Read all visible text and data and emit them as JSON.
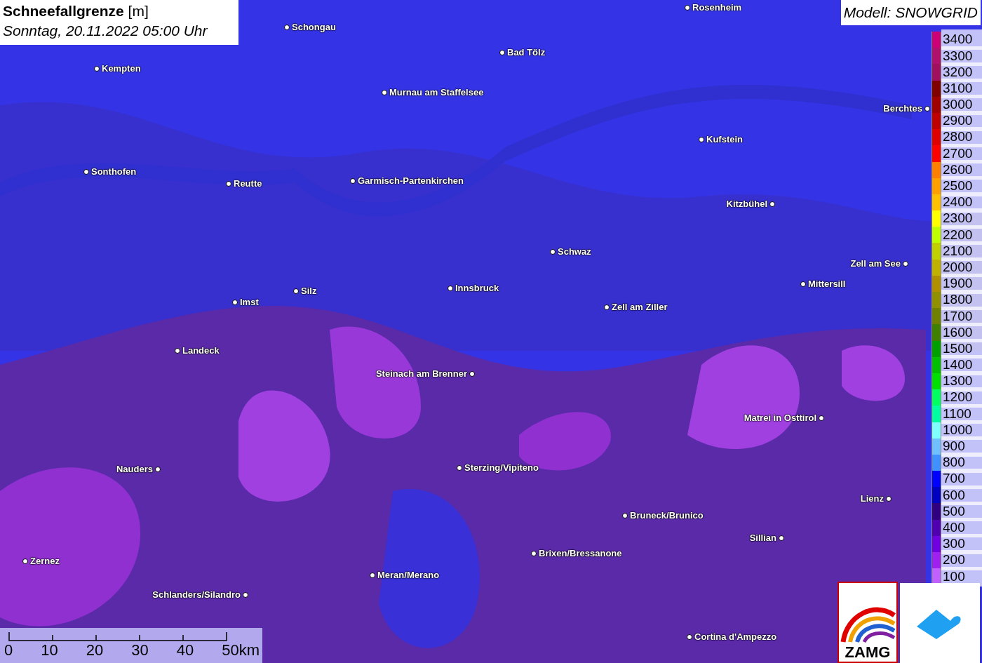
{
  "title": {
    "name": "Schneefallgrenze",
    "unit": "[m]",
    "date": "Sonntag, 20.11.2022 05:00 Uhr"
  },
  "model": "Modell: SNOWGRID",
  "cities": [
    {
      "name": "Rosenheim"
    },
    {
      "name": "Schongau"
    },
    {
      "name": "Bad Tölz"
    },
    {
      "name": "Kempten"
    },
    {
      "name": "Murnau am Staffelsee"
    },
    {
      "name": "Berchtes"
    },
    {
      "name": "Kufstein"
    },
    {
      "name": "Sonthofen"
    },
    {
      "name": "Garmisch-Partenkirchen"
    },
    {
      "name": "Reutte"
    },
    {
      "name": "Kitzbühel"
    },
    {
      "name": "Schwaz"
    },
    {
      "name": "Zell am See"
    },
    {
      "name": "Mittersill"
    },
    {
      "name": "Innsbruck"
    },
    {
      "name": "Silz"
    },
    {
      "name": "Imst"
    },
    {
      "name": "Zell am Ziller"
    },
    {
      "name": "Landeck"
    },
    {
      "name": "Steinach am Brenner"
    },
    {
      "name": "Matrei in Osttirol"
    },
    {
      "name": "Nauders"
    },
    {
      "name": "Sterzing/Vipiteno"
    },
    {
      "name": "Lienz"
    },
    {
      "name": "Bruneck/Brunico"
    },
    {
      "name": "Sillian"
    },
    {
      "name": "Brixen/Bressanone"
    },
    {
      "name": "Zernez"
    },
    {
      "name": "Meran/Merano"
    },
    {
      "name": "Schlanders/Silandro"
    },
    {
      "name": "Cortina d'Ampezzo"
    }
  ],
  "legend": [
    {
      "label": "3400",
      "color": "#cc0077"
    },
    {
      "label": "3300",
      "color": "#b0106e"
    },
    {
      "label": "3200",
      "color": "#a0105f"
    },
    {
      "label": "3100",
      "color": "#800000"
    },
    {
      "label": "3000",
      "color": "#a00000"
    },
    {
      "label": "2900",
      "color": "#c00000"
    },
    {
      "label": "2800",
      "color": "#e00000"
    },
    {
      "label": "2700",
      "color": "#ff0000"
    },
    {
      "label": "2600",
      "color": "#ff8000"
    },
    {
      "label": "2500",
      "color": "#ffa000"
    },
    {
      "label": "2400",
      "color": "#ffc000"
    },
    {
      "label": "2300",
      "color": "#ffff00"
    },
    {
      "label": "2200",
      "color": "#c0ff00"
    },
    {
      "label": "2100",
      "color": "#c0d000"
    },
    {
      "label": "2000",
      "color": "#c0b000"
    },
    {
      "label": "1900",
      "color": "#b09000"
    },
    {
      "label": "1800",
      "color": "#909000"
    },
    {
      "label": "1700",
      "color": "#708000"
    },
    {
      "label": "1600",
      "color": "#408000"
    },
    {
      "label": "1500",
      "color": "#00a000"
    },
    {
      "label": "1400",
      "color": "#00c000"
    },
    {
      "label": "1300",
      "color": "#00e000"
    },
    {
      "label": "1200",
      "color": "#00ff60"
    },
    {
      "label": "1100",
      "color": "#00ffa0"
    },
    {
      "label": "1000",
      "color": "#80ffff"
    },
    {
      "label": "900",
      "color": "#70c0ff"
    },
    {
      "label": "800",
      "color": "#4090ff"
    },
    {
      "label": "700",
      "color": "#0000ff"
    },
    {
      "label": "600",
      "color": "#0000c0"
    },
    {
      "label": "500",
      "color": "#300080"
    },
    {
      "label": "400",
      "color": "#5000b0"
    },
    {
      "label": "300",
      "color": "#7000e0"
    },
    {
      "label": "200",
      "color": "#a020f0"
    },
    {
      "label": "100",
      "color": "#c060ff"
    }
  ],
  "scale": [
    "0",
    "10",
    "20",
    "30",
    "40",
    "50km"
  ],
  "logo": "ZAMG"
}
